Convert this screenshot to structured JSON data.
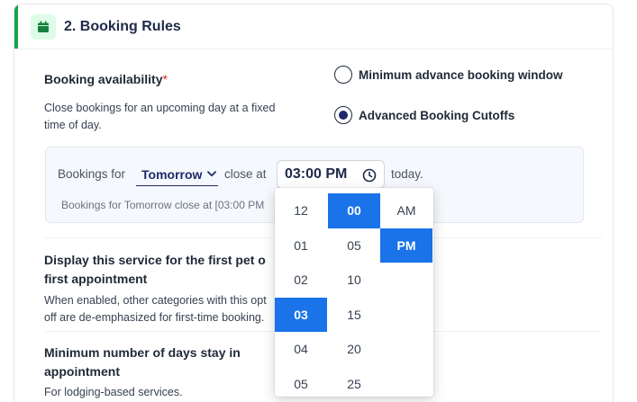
{
  "section": {
    "number": "2.",
    "title": "Booking Rules",
    "icon": "calendar-icon",
    "accent_color": "#16a34a"
  },
  "availability": {
    "label": "Booking availability",
    "required_mark": "*",
    "description_line1": "Close bookings for an upcoming day at a fixed",
    "description_line2": "time of day.",
    "options": [
      {
        "label": "Minimum advance booking window",
        "selected": false
      },
      {
        "label": "Advanced Booking Cutoffs",
        "selected": true
      }
    ]
  },
  "cutoff": {
    "prefix": "Bookings for",
    "day_value": "Tomorrow",
    "close_at": "close at",
    "time_value": "03:00 PM",
    "suffix": "today.",
    "hint": "Bookings for Tomorrow close at [03:00 PM"
  },
  "first_pet": {
    "title_line1": "Display this service for the first pet o",
    "title_line2": "first appointment",
    "desc_line1": "When enabled, other categories with this opt",
    "desc_line2": "off are de-emphasized for first-time booking."
  },
  "min_days": {
    "title_line1": "Minimum number of days stay in",
    "title_line2": "appointment",
    "desc": "For lodging-based services."
  },
  "time_picker": {
    "hours": [
      "12",
      "01",
      "02",
      "03",
      "04",
      "05"
    ],
    "minutes": [
      "00",
      "05",
      "10",
      "15",
      "20",
      "25"
    ],
    "periods": [
      "AM",
      "PM"
    ],
    "selected_hour": "03",
    "selected_minute": "00",
    "selected_period": "PM",
    "highlight_color": "#1a73e8"
  }
}
